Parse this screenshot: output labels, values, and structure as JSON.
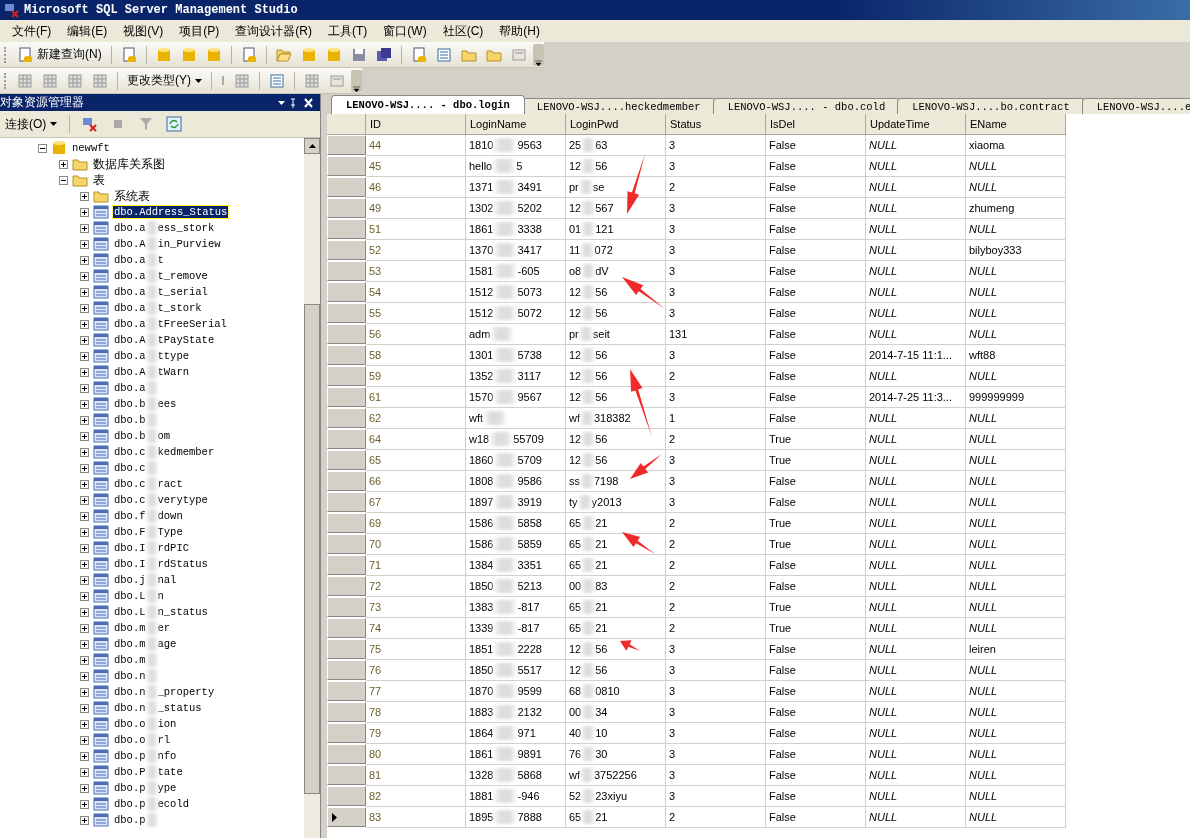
{
  "window": {
    "title": "Microsoft SQL Server Management Studio"
  },
  "menu": [
    "文件(F)",
    "编辑(E)",
    "视图(V)",
    "项目(P)",
    "查询设计器(R)",
    "工具(T)",
    "窗口(W)",
    "社区(C)",
    "帮助(H)"
  ],
  "toolbar": {
    "new_query": "新建查询(N)"
  },
  "toolbar2": {
    "change_type": "更改类型(Y)"
  },
  "object_explorer": {
    "title": "对象资源管理器",
    "connect": "连接(O)",
    "tree": [
      {
        "label": "newwft",
        "kind": "database",
        "expanded": true,
        "selected": false,
        "children": [
          {
            "label": "数据库关系图",
            "kind": "folder",
            "expanded": false,
            "selected": false
          },
          {
            "label": "表",
            "kind": "folder",
            "expanded": true,
            "selected": false,
            "children": [
              {
                "label": "系统表",
                "kind": "folder",
                "expanded": false,
                "selected": false
              },
              {
                "label": "dbo.Address_Status",
                "kind": "table",
                "expanded": false,
                "selected": true
              },
              {
                "label": [
                  "dbo.a",
                  "ess_stork"
                ],
                "kind": "table",
                "expanded": false,
                "selected": false
              },
              {
                "label": [
                  "dbo.A",
                  "in_Purview"
                ],
                "kind": "table",
                "expanded": false,
                "selected": false
              },
              {
                "label": [
                  "dbo.a",
                  "t"
                ],
                "kind": "table",
                "expanded": false,
                "selected": false
              },
              {
                "label": [
                  "dbo.a",
                  "t_remove"
                ],
                "kind": "table",
                "expanded": false,
                "selected": false
              },
              {
                "label": [
                  "dbo.a",
                  "t_serial"
                ],
                "kind": "table",
                "expanded": false,
                "selected": false
              },
              {
                "label": [
                  "dbo.a",
                  "t_stork"
                ],
                "kind": "table",
                "expanded": false,
                "selected": false
              },
              {
                "label": [
                  "dbo.a",
                  "tFreeSerial"
                ],
                "kind": "table",
                "expanded": false,
                "selected": false
              },
              {
                "label": [
                  "dbo.A",
                  "tPayState"
                ],
                "kind": "table",
                "expanded": false,
                "selected": false
              },
              {
                "label": [
                  "dbo.a",
                  "ttype"
                ],
                "kind": "table",
                "expanded": false,
                "selected": false
              },
              {
                "label": [
                  "dbo.A",
                  "tWarn"
                ],
                "kind": "table",
                "expanded": false,
                "selected": false
              },
              {
                "label": [
                  "dbo.a"
                ],
                "kind": "table",
                "expanded": false,
                "selected": false
              },
              {
                "label": [
                  "dbo.b",
                  "ees"
                ],
                "kind": "table",
                "expanded": false,
                "selected": false
              },
              {
                "label": [
                  "dbo.b"
                ],
                "kind": "table",
                "expanded": false,
                "selected": false
              },
              {
                "label": [
                  "dbo.b",
                  "om"
                ],
                "kind": "table",
                "expanded": false,
                "selected": false
              },
              {
                "label": [
                  "dbo.c",
                  "kedmember"
                ],
                "kind": "table",
                "expanded": false,
                "selected": false
              },
              {
                "label": [
                  "dbo.c"
                ],
                "kind": "table",
                "expanded": false,
                "selected": false
              },
              {
                "label": [
                  "dbo.c",
                  "ract"
                ],
                "kind": "table",
                "expanded": false,
                "selected": false
              },
              {
                "label": [
                  "dbo.c",
                  "verytype"
                ],
                "kind": "table",
                "expanded": false,
                "selected": false
              },
              {
                "label": [
                  "dbo.f",
                  "down"
                ],
                "kind": "table",
                "expanded": false,
                "selected": false
              },
              {
                "label": [
                  "dbo.F",
                  "Type"
                ],
                "kind": "table",
                "expanded": false,
                "selected": false
              },
              {
                "label": [
                  "dbo.I",
                  "rdPIC"
                ],
                "kind": "table",
                "expanded": false,
                "selected": false
              },
              {
                "label": [
                  "dbo.I",
                  "rdStatus"
                ],
                "kind": "table",
                "expanded": false,
                "selected": false
              },
              {
                "label": [
                  "dbo.j",
                  "nal"
                ],
                "kind": "table",
                "expanded": false,
                "selected": false
              },
              {
                "label": [
                  "dbo.L",
                  "n"
                ],
                "kind": "table",
                "expanded": false,
                "selected": false
              },
              {
                "label": [
                  "dbo.L",
                  "n_status"
                ],
                "kind": "table",
                "expanded": false,
                "selected": false
              },
              {
                "label": [
                  "dbo.m",
                  "er"
                ],
                "kind": "table",
                "expanded": false,
                "selected": false
              },
              {
                "label": [
                  "dbo.m",
                  "age"
                ],
                "kind": "table",
                "expanded": false,
                "selected": false
              },
              {
                "label": [
                  "dbo.m"
                ],
                "kind": "table",
                "expanded": false,
                "selected": false
              },
              {
                "label": [
                  "dbo.n"
                ],
                "kind": "table",
                "expanded": false,
                "selected": false
              },
              {
                "label": [
                  "dbo.n",
                  "_property"
                ],
                "kind": "table",
                "expanded": false,
                "selected": false
              },
              {
                "label": [
                  "dbo.n",
                  "_status"
                ],
                "kind": "table",
                "expanded": false,
                "selected": false
              },
              {
                "label": [
                  "dbo.o",
                  "ion"
                ],
                "kind": "table",
                "expanded": false,
                "selected": false
              },
              {
                "label": [
                  "dbo.o",
                  "rl"
                ],
                "kind": "table",
                "expanded": false,
                "selected": false
              },
              {
                "label": [
                  "dbo.p",
                  "nfo"
                ],
                "kind": "table",
                "expanded": false,
                "selected": false
              },
              {
                "label": [
                  "dbo.P",
                  "tate"
                ],
                "kind": "table",
                "expanded": false,
                "selected": false
              },
              {
                "label": [
                  "dbo.p",
                  "ype"
                ],
                "kind": "table",
                "expanded": false,
                "selected": false
              },
              {
                "label": [
                  "dbo.p",
                  "ecold"
                ],
                "kind": "table",
                "expanded": false,
                "selected": false
              },
              {
                "label": [
                  "dbo.p"
                ],
                "kind": "table",
                "expanded": false,
                "selected": false
              }
            ]
          }
        ]
      }
    ]
  },
  "tabs": [
    {
      "label": "LENOVO-WSJ.... - dbo.login",
      "selected": true
    },
    {
      "label": "LENOVO-WSJ....heckedmember",
      "selected": false
    },
    {
      "label": "LENOVO-WSJ.... - dbo.cold",
      "selected": false
    },
    {
      "label": "LENOVO-WSJ....bo.contract",
      "selected": false
    },
    {
      "label": "LENOVO-WSJ....e",
      "selected": false
    }
  ],
  "grid": {
    "columns": [
      "ID",
      "LoginName",
      "LoginPwd",
      "Status",
      "IsDel",
      "UpdateTime",
      "EName"
    ],
    "rows": [
      {
        "current": false,
        "cells": [
          "44",
          [
            "1810",
            "9563"
          ],
          [
            "25",
            "63"
          ],
          "3",
          "False",
          {
            "kind": "null",
            "text": "NULL"
          },
          "xiaoma"
        ]
      },
      {
        "current": false,
        "cells": [
          "45",
          [
            "hello",
            "5"
          ],
          [
            "12",
            "56"
          ],
          "3",
          "False",
          {
            "kind": "null",
            "text": "NULL"
          },
          {
            "kind": "null",
            "text": "NULL"
          }
        ]
      },
      {
        "current": false,
        "cells": [
          "46",
          [
            "1371",
            "3491"
          ],
          [
            "pr",
            "se"
          ],
          "2",
          "False",
          {
            "kind": "null",
            "text": "NULL"
          },
          {
            "kind": "null",
            "text": "NULL"
          }
        ]
      },
      {
        "current": false,
        "cells": [
          "49",
          [
            "1302",
            "5202"
          ],
          [
            "12",
            "567"
          ],
          "3",
          "False",
          {
            "kind": "null",
            "text": "NULL"
          },
          "zhumeng"
        ]
      },
      {
        "current": false,
        "cells": [
          "51",
          [
            "1861",
            "3338"
          ],
          [
            "01",
            "121"
          ],
          "3",
          "False",
          {
            "kind": "null",
            "text": "NULL"
          },
          {
            "kind": "null",
            "text": "NULL"
          }
        ]
      },
      {
        "current": false,
        "cells": [
          "52",
          [
            "1370",
            "3417"
          ],
          [
            "11",
            "072"
          ],
          "3",
          "False",
          {
            "kind": "null",
            "text": "NULL"
          },
          "bilyboy333"
        ]
      },
      {
        "current": false,
        "cells": [
          "53",
          [
            "1581",
            "-605"
          ],
          [
            "o8",
            "dV"
          ],
          "3",
          "False",
          {
            "kind": "null",
            "text": "NULL"
          },
          {
            "kind": "null",
            "text": "NULL"
          }
        ]
      },
      {
        "current": false,
        "cells": [
          "54",
          [
            "1512",
            "5073"
          ],
          [
            "12",
            "56"
          ],
          "3",
          "False",
          {
            "kind": "null",
            "text": "NULL"
          },
          {
            "kind": "null",
            "text": "NULL"
          }
        ]
      },
      {
        "current": false,
        "cells": [
          "55",
          [
            "1512",
            "5072"
          ],
          [
            "12",
            "56"
          ],
          "3",
          "False",
          {
            "kind": "null",
            "text": "NULL"
          },
          {
            "kind": "null",
            "text": "NULL"
          }
        ]
      },
      {
        "current": false,
        "cells": [
          "56",
          [
            "adm"
          ],
          [
            "pr",
            "seit"
          ],
          "131",
          "False",
          {
            "kind": "null",
            "text": "NULL"
          },
          {
            "kind": "null",
            "text": "NULL"
          }
        ]
      },
      {
        "current": false,
        "cells": [
          "58",
          [
            "1301",
            "5738"
          ],
          [
            "12",
            "56"
          ],
          "3",
          "False",
          "2014-7-15 11:1...",
          "wft88"
        ]
      },
      {
        "current": false,
        "cells": [
          "59",
          [
            "1352",
            "3117"
          ],
          [
            "12",
            "56"
          ],
          "2",
          "False",
          {
            "kind": "null",
            "text": "NULL"
          },
          {
            "kind": "null",
            "text": "NULL"
          }
        ]
      },
      {
        "current": false,
        "cells": [
          "61",
          [
            "1570",
            "9567"
          ],
          [
            "12",
            "56"
          ],
          "3",
          "False",
          "2014-7-25 11:3...",
          "999999999"
        ]
      },
      {
        "current": false,
        "cells": [
          "62",
          [
            "wft"
          ],
          [
            "wf",
            "318382"
          ],
          "1",
          "False",
          {
            "kind": "null",
            "text": "NULL"
          },
          {
            "kind": "null",
            "text": "NULL"
          }
        ]
      },
      {
        "current": false,
        "cells": [
          "64",
          [
            "w18",
            "55709"
          ],
          [
            "12",
            "56"
          ],
          "2",
          "True",
          {
            "kind": "null",
            "text": "NULL"
          },
          {
            "kind": "null",
            "text": "NULL"
          }
        ]
      },
      {
        "current": false,
        "cells": [
          "65",
          [
            "1860",
            "5709"
          ],
          [
            "12",
            "56"
          ],
          "3",
          "True",
          {
            "kind": "null",
            "text": "NULL"
          },
          {
            "kind": "null",
            "text": "NULL"
          }
        ]
      },
      {
        "current": false,
        "cells": [
          "66",
          [
            "1808",
            "9586"
          ],
          [
            "ss",
            "7198"
          ],
          "3",
          "False",
          {
            "kind": "null",
            "text": "NULL"
          },
          {
            "kind": "null",
            "text": "NULL"
          }
        ]
      },
      {
        "current": false,
        "cells": [
          "67",
          [
            "1897",
            "3919"
          ],
          [
            "ty",
            "y2013"
          ],
          "3",
          "False",
          {
            "kind": "null",
            "text": "NULL"
          },
          {
            "kind": "null",
            "text": "NULL"
          }
        ]
      },
      {
        "current": false,
        "cells": [
          "69",
          [
            "1586",
            "5858"
          ],
          [
            "65",
            "21"
          ],
          "2",
          "True",
          {
            "kind": "null",
            "text": "NULL"
          },
          {
            "kind": "null",
            "text": "NULL"
          }
        ]
      },
      {
        "current": false,
        "cells": [
          "70",
          [
            "1586",
            "5859"
          ],
          [
            "65",
            "21"
          ],
          "2",
          "True",
          {
            "kind": "null",
            "text": "NULL"
          },
          {
            "kind": "null",
            "text": "NULL"
          }
        ]
      },
      {
        "current": false,
        "cells": [
          "71",
          [
            "1384",
            "3351"
          ],
          [
            "65",
            "21"
          ],
          "2",
          "False",
          {
            "kind": "null",
            "text": "NULL"
          },
          {
            "kind": "null",
            "text": "NULL"
          }
        ]
      },
      {
        "current": false,
        "cells": [
          "72",
          [
            "1850",
            "5213"
          ],
          [
            "00",
            "83"
          ],
          "2",
          "False",
          {
            "kind": "null",
            "text": "NULL"
          },
          {
            "kind": "null",
            "text": "NULL"
          }
        ]
      },
      {
        "current": false,
        "cells": [
          "73",
          [
            "1383",
            "-817"
          ],
          [
            "65",
            "21"
          ],
          "2",
          "True",
          {
            "kind": "null",
            "text": "NULL"
          },
          {
            "kind": "null",
            "text": "NULL"
          }
        ]
      },
      {
        "current": false,
        "cells": [
          "74",
          [
            "1339",
            "-817"
          ],
          [
            "65",
            "21"
          ],
          "2",
          "True",
          {
            "kind": "null",
            "text": "NULL"
          },
          {
            "kind": "null",
            "text": "NULL"
          }
        ]
      },
      {
        "current": false,
        "cells": [
          "75",
          [
            "1851",
            "2228"
          ],
          [
            "12",
            "56"
          ],
          "3",
          "False",
          {
            "kind": "null",
            "text": "NULL"
          },
          "leiren"
        ]
      },
      {
        "current": false,
        "cells": [
          "76",
          [
            "1850",
            "5517"
          ],
          [
            "12",
            "56"
          ],
          "3",
          "False",
          {
            "kind": "null",
            "text": "NULL"
          },
          {
            "kind": "null",
            "text": "NULL"
          }
        ]
      },
      {
        "current": false,
        "cells": [
          "77",
          [
            "1870",
            "9599"
          ],
          [
            "68",
            "0810"
          ],
          "3",
          "False",
          {
            "kind": "null",
            "text": "NULL"
          },
          {
            "kind": "null",
            "text": "NULL"
          }
        ]
      },
      {
        "current": false,
        "cells": [
          "78",
          [
            "1883",
            "2132"
          ],
          [
            "00",
            "34"
          ],
          "3",
          "False",
          {
            "kind": "null",
            "text": "NULL"
          },
          {
            "kind": "null",
            "text": "NULL"
          }
        ]
      },
      {
        "current": false,
        "cells": [
          "79",
          [
            "1864",
            "971"
          ],
          [
            "40",
            "10"
          ],
          "3",
          "False",
          {
            "kind": "null",
            "text": "NULL"
          },
          {
            "kind": "null",
            "text": "NULL"
          }
        ]
      },
      {
        "current": false,
        "cells": [
          "80",
          [
            "1861",
            "9891"
          ],
          [
            "76",
            "30"
          ],
          "3",
          "False",
          {
            "kind": "null",
            "text": "NULL"
          },
          {
            "kind": "null",
            "text": "NULL"
          }
        ]
      },
      {
        "current": false,
        "cells": [
          "81",
          [
            "1328",
            "5868"
          ],
          [
            "wf",
            "3752256"
          ],
          "3",
          "False",
          {
            "kind": "null",
            "text": "NULL"
          },
          {
            "kind": "null",
            "text": "NULL"
          }
        ]
      },
      {
        "current": false,
        "cells": [
          "82",
          [
            "1881",
            "-946"
          ],
          [
            "52",
            "23xiyu"
          ],
          "3",
          "False",
          {
            "kind": "null",
            "text": "NULL"
          },
          {
            "kind": "null",
            "text": "NULL"
          }
        ]
      },
      {
        "current": true,
        "cells": [
          "83",
          [
            "1895",
            "7888"
          ],
          [
            "65",
            "21"
          ],
          "2",
          "False",
          {
            "kind": "null",
            "text": "NULL"
          },
          {
            "kind": "null",
            "text": "NULL"
          }
        ]
      }
    ]
  }
}
